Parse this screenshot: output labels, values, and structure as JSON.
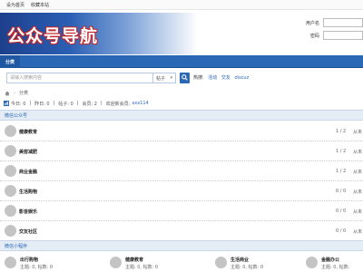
{
  "topbar": {
    "links": [
      "设为首页",
      "收藏本站"
    ]
  },
  "header": {
    "logo_text": "公众号导航"
  },
  "login": {
    "username_label": "用户名",
    "password_label": "密码",
    "username_value": "",
    "password_value": ""
  },
  "nav": {
    "tabs": [
      "分类"
    ]
  },
  "search": {
    "placeholder": "请输入搜索内容",
    "type_label": "帖子",
    "hot_label": "热搜:",
    "hot_links": [
      "活动",
      "交友",
      "discuz"
    ]
  },
  "breadcrumb": {
    "items": [
      "分类"
    ]
  },
  "stats": {
    "today": "今日: 0",
    "yesterday": "昨日: 0",
    "posts": "帖子: 0",
    "members": "会员: 2",
    "welcome_label": "欢迎新会员:",
    "new_member": "xxx114"
  },
  "groups": [
    {
      "title": "微信公众号",
      "forums": [
        {
          "name": "健康教育",
          "count": "1 / 2",
          "last": "从未"
        },
        {
          "name": "美容减肥",
          "count": "1 / 2",
          "last": "从未"
        },
        {
          "name": "商业金融",
          "count": "1 / 2",
          "last": "从未"
        },
        {
          "name": "生活购物",
          "count": "0 / 0",
          "last": "从未"
        },
        {
          "name": "影音娱乐",
          "count": "0 / 0",
          "last": "从未"
        },
        {
          "name": "交友社区",
          "count": "0 / 0",
          "last": "从未"
        }
      ]
    },
    {
      "title": "微信小程序",
      "forums": [
        {
          "name": "出行购物",
          "stats": "主题: 0, 帖数: 0"
        },
        {
          "name": "健康教育",
          "stats": "主题: 0, 帖数: 0"
        },
        {
          "name": "生活商业",
          "stats": "主题: 0, 帖数: 0"
        },
        {
          "name": "金融办公",
          "stats": "主题: 0, 帖数:"
        }
      ]
    }
  ],
  "colors": {
    "brand_blue": "#2a68b5",
    "header_bg": "#e4ecf5",
    "logo_outline": "#c1272d"
  }
}
